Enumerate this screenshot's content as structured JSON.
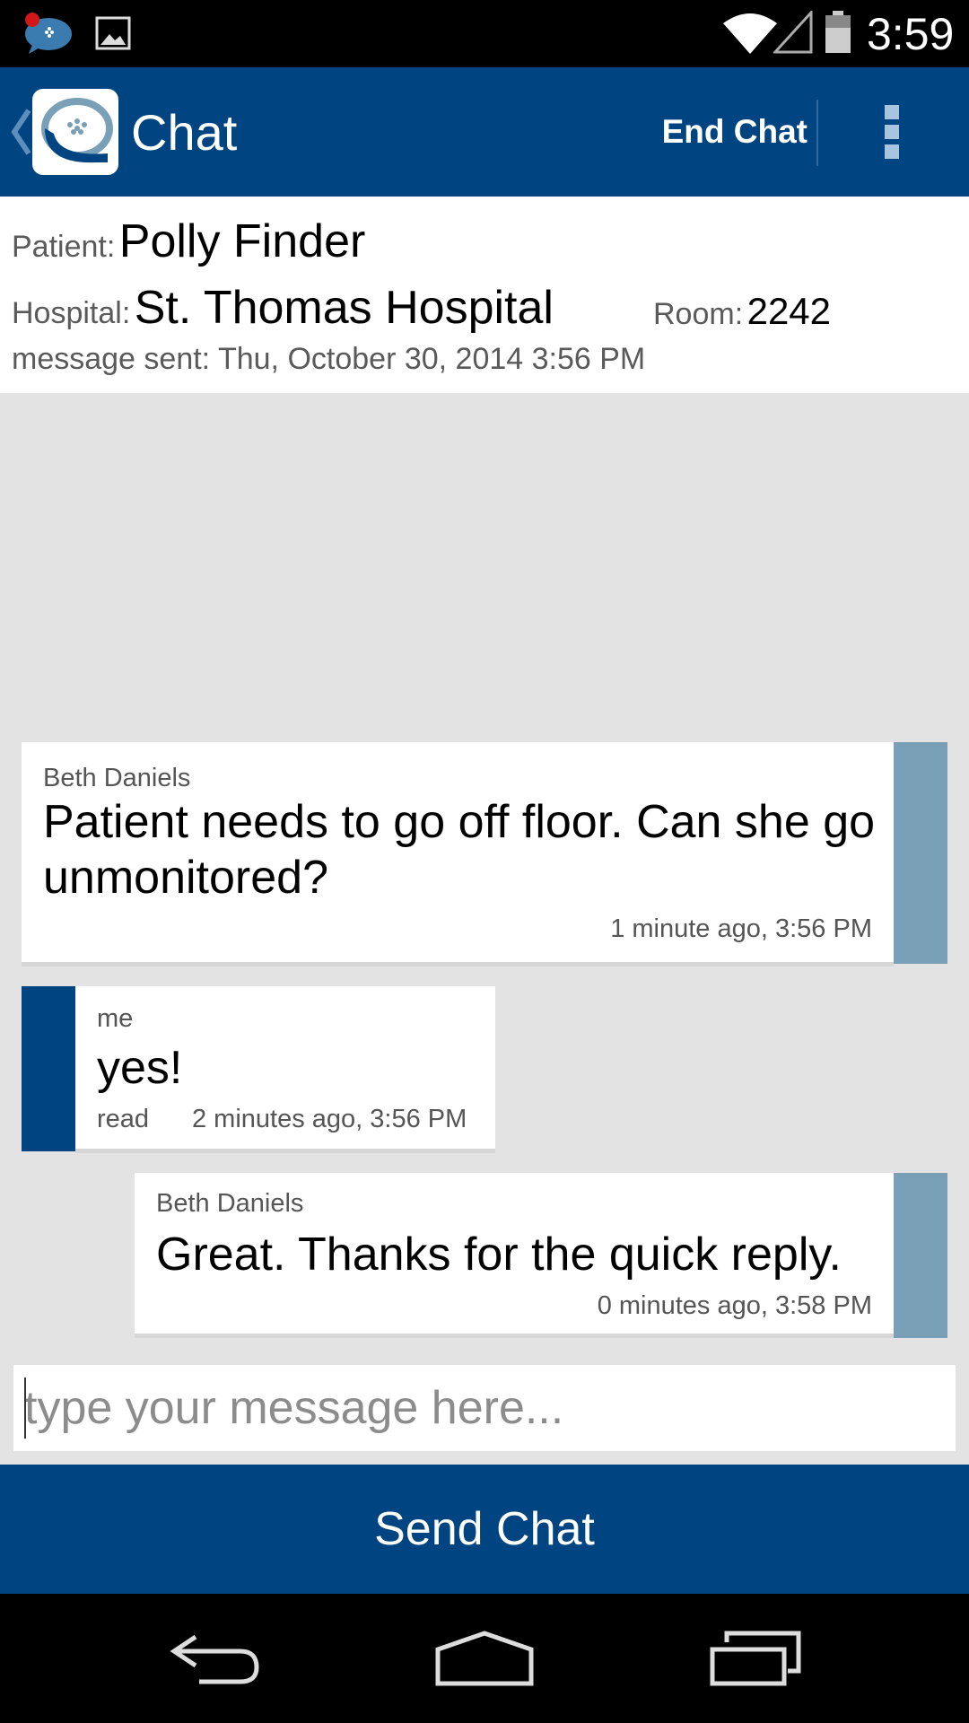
{
  "status_bar": {
    "time": "3:59"
  },
  "action_bar": {
    "title": "Chat",
    "end_chat_label": "End Chat"
  },
  "header": {
    "patient_label": "Patient:",
    "patient_name": "Polly Finder",
    "hospital_label": "Hospital:",
    "hospital_name": "St. Thomas Hospital",
    "room_label": "Room:",
    "room_number": "2242",
    "sent_label": "message sent:",
    "sent_time": "Thu, October 30, 2014 3:56 PM"
  },
  "messages": [
    {
      "sender": "Beth Daniels",
      "text": "Patient needs to go off floor.  Can she go unmonitored?",
      "time": "1 minute ago, 3:56 PM"
    },
    {
      "sender": "me",
      "text": "yes!",
      "status": "read",
      "time": "2 minutes ago, 3:56 PM"
    },
    {
      "sender": "Beth Daniels",
      "text": "Great. Thanks for the quick reply.",
      "time": "0 minutes ago, 3:58 PM"
    }
  ],
  "composer": {
    "placeholder": "type your message here...",
    "value": ""
  },
  "send_button_label": "Send Chat",
  "colors": {
    "brand_blue": "#004482",
    "incoming_tab": "#7aa0b8",
    "chat_bg": "#e3e3e3"
  }
}
